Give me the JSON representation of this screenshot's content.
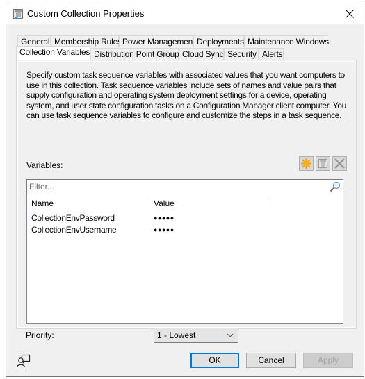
{
  "window": {
    "title": "Custom Collection Properties",
    "icon": "properties-window-icon",
    "close_icon": "close-icon"
  },
  "tabs": {
    "row1": [
      {
        "label": "General"
      },
      {
        "label": "Membership Rules"
      },
      {
        "label": "Power Management"
      },
      {
        "label": "Deployments"
      },
      {
        "label": "Maintenance Windows"
      }
    ],
    "row2": [
      {
        "label": "Collection Variables",
        "active": true
      },
      {
        "label": "Distribution Point Groups"
      },
      {
        "label": "Cloud Sync"
      },
      {
        "label": "Security"
      },
      {
        "label": "Alerts"
      }
    ]
  },
  "panel": {
    "description": "Specify custom task sequence variables with associated values that you want computers to use in this collection. Task sequence variables include sets of names and value pairs that supply configuration and operating system deployment settings for a device, operating system, and user state configuration tasks on a Configuration Manager client computer. You can use task sequence variables to configure and customize the steps in a task sequence.",
    "variables_label": "Variables:",
    "toolbar": {
      "new_icon": "new-variable-icon",
      "properties_icon": "properties-icon",
      "delete_icon": "delete-icon"
    },
    "filter": {
      "placeholder": "Filter...",
      "value": ""
    },
    "list": {
      "columns": [
        "Name",
        "Value"
      ],
      "rows": [
        {
          "name": "CollectionEnvPassword",
          "value": "●●●●●"
        },
        {
          "name": "CollectionEnvUsername",
          "value": "●●●●●"
        }
      ]
    },
    "priority": {
      "label": "Priority:",
      "selected": "1 - Lowest"
    }
  },
  "footer": {
    "ok": "OK",
    "cancel": "Cancel",
    "apply": "Apply"
  },
  "colors": {
    "accent": "#0078d7",
    "new_icon": "#f5a200",
    "disabled_text": "#a0a0a0"
  }
}
